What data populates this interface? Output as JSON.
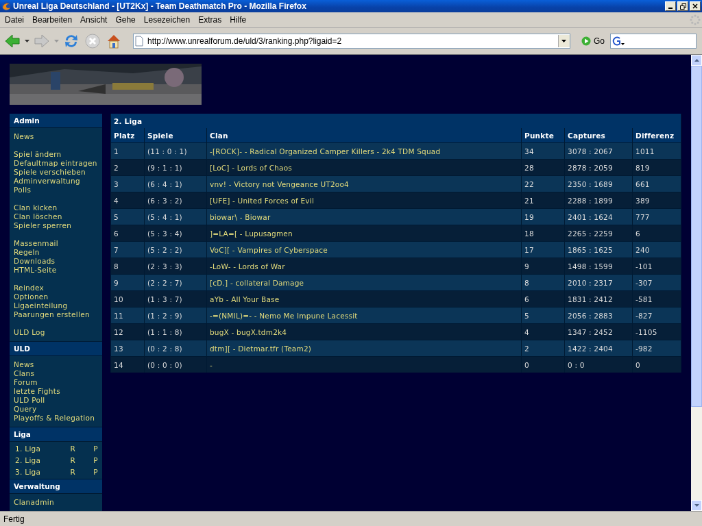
{
  "window": {
    "title": "Unreal Liga Deutschland - [UT2Kx] - Team Deathmatch Pro - Mozilla Firefox"
  },
  "menu": [
    "Datei",
    "Bearbeiten",
    "Ansicht",
    "Gehe",
    "Lesezeichen",
    "Extras",
    "Hilfe"
  ],
  "address_bar": {
    "value": "http://www.unrealforum.de/uld/3/ranking.php?ligaid=2"
  },
  "go_button": "Go",
  "sidebar": [
    {
      "title": "Admin",
      "kind": "links",
      "groups": [
        [
          "News"
        ],
        [
          "Spiel ändern",
          "Defaultmap eintragen",
          "Spiele verschieben",
          "Adminverwaltung",
          "Polls"
        ],
        [
          "Clan kicken",
          "Clan löschen",
          "Spieler sperren"
        ],
        [
          "Massenmail",
          "Regeln",
          "Downloads",
          "HTML-Seite"
        ],
        [
          "Reindex",
          "Optionen",
          "Ligaeinteilung",
          "Paarungen erstellen"
        ],
        [
          "ULD Log"
        ]
      ]
    },
    {
      "title": "ULD",
      "kind": "links",
      "groups": [
        [
          "News",
          "Clans",
          "Forum",
          "letzte Fights",
          "ULD Poll",
          "Query",
          "Playoffs & Relegation"
        ]
      ]
    },
    {
      "title": "Liga",
      "kind": "leagues",
      "rows": [
        {
          "name": "1. Liga",
          "r": "R",
          "p": "P"
        },
        {
          "name": "2. Liga",
          "r": "R",
          "p": "P"
        },
        {
          "name": "3. Liga",
          "r": "R",
          "p": "P"
        }
      ]
    },
    {
      "title": "Verwaltung",
      "kind": "links",
      "groups": [
        [
          "Clanadmin"
        ]
      ]
    }
  ],
  "table": {
    "title": "2. Liga",
    "columns": [
      "Platz",
      "Spiele",
      "Clan",
      "Punkte",
      "Captures",
      "Differenz"
    ],
    "rows": [
      [
        "1",
        "(11 : 0 : 1)",
        "-[ROCK]- - Radical Organized Camper Killers - 2k4 TDM Squad",
        "34",
        "3078 : 2067",
        "1011"
      ],
      [
        "2",
        "(9 : 1 : 1)",
        "[LoC] - Lords of Chaos",
        "28",
        "2878 : 2059",
        "819"
      ],
      [
        "3",
        "(6 : 4 : 1)",
        "vnv! - Victory not Vengeance UT2oo4",
        "22",
        "2350 : 1689",
        "661"
      ],
      [
        "4",
        "(6 : 3 : 2)",
        "[UFE] - United Forces of Evil",
        "21",
        "2288 : 1899",
        "389"
      ],
      [
        "5",
        "(5 : 4 : 1)",
        "biowar\\ - Biowar",
        "19",
        "2401 : 1624",
        "777"
      ],
      [
        "6",
        "(5 : 3 : 4)",
        "]=LA=[ - Lupusagmen",
        "18",
        "2265 : 2259",
        "6"
      ],
      [
        "7",
        "(5 : 2 : 2)",
        "VoC][ - Vampires of Cyberspace",
        "17",
        "1865 : 1625",
        "240"
      ],
      [
        "8",
        "(2 : 3 : 3)",
        "-LoW- - Lords of War",
        "9",
        "1498 : 1599",
        "-101"
      ],
      [
        "9",
        "(2 : 2 : 7)",
        "[cD.] - collateral Damage",
        "8",
        "2010 : 2317",
        "-307"
      ],
      [
        "10",
        "(1 : 3 : 7)",
        "aYb - All Your Base",
        "6",
        "1831 : 2412",
        "-581"
      ],
      [
        "11",
        "(1 : 2 : 9)",
        "-=(NMIL)=- - Nemo Me Impune Lacessit",
        "5",
        "2056 : 2883",
        "-827"
      ],
      [
        "12",
        "(1 : 1 : 8)",
        "bugX - bugX.tdm2k4",
        "4",
        "1347 : 2452",
        "-1105"
      ],
      [
        "13",
        "(0 : 2 : 8)",
        "dtm][ - Dietmar.tfr (Team2)",
        "2",
        "1422 : 2404",
        "-982"
      ],
      [
        "14",
        "(0 : 0 : 0)",
        "-",
        "0",
        "0 : 0",
        "0"
      ]
    ]
  },
  "status_bar": "Fertig"
}
